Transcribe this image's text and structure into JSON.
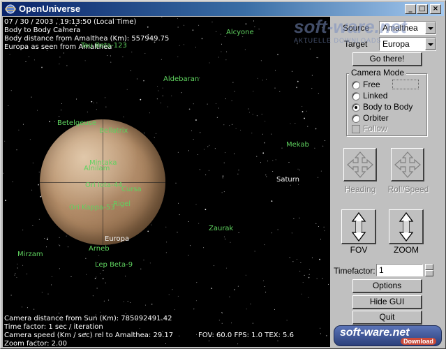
{
  "window": {
    "title": "OpenUniverse",
    "controls": {
      "minimize": "_",
      "maximize": "□",
      "close": "×"
    }
  },
  "hud": {
    "top_lines": [
      "07 / 30 / 2003 , 19:13:50 (Local Time)",
      "Body to Body Camera",
      "Body distance from Amalthea (Km): 557949.75",
      "Europa as seen from Amalthea"
    ],
    "bottom_lines": [
      "Camera distance from Sun (Km): 785092491.42",
      "Time factor: 1 sec / iteration",
      "Camera speed (Km / sec) rel to Amalthea: 29.17",
      "Zoom factor: 2.00"
    ],
    "stats": "FOV: 60.0  FPS: 1.0 TEX: 5.6"
  },
  "stars": [
    {
      "name": "Alcyone"
    },
    {
      "name": "Tau Beta-123"
    },
    {
      "name": "Aldebaran"
    },
    {
      "name": "Betelgeuse"
    },
    {
      "name": "Bellatrix"
    },
    {
      "name": "Mintaka"
    },
    {
      "name": "Alnilam"
    },
    {
      "name": "Ori Iota-44"
    },
    {
      "name": "Cursa"
    },
    {
      "name": "Rigel"
    },
    {
      "name": "Ori Kappa-53"
    },
    {
      "name": "Mekab"
    },
    {
      "name": "Zaurak"
    },
    {
      "name": "Arneb"
    },
    {
      "name": "Mirzam"
    },
    {
      "name": "Lep Beta-9"
    }
  ],
  "bodies": {
    "saturn": "Saturn",
    "europa": "Europa"
  },
  "panel": {
    "source_label": "Source",
    "source_value": "Amalthea",
    "target_label": "Target",
    "target_value": "Europa",
    "go_button": "Go there!",
    "camera_mode": {
      "title": "Camera Mode",
      "options": [
        "Free",
        "Linked",
        "Body to Body",
        "Orbiter"
      ],
      "selected": "Body to Body",
      "follow_label": "Follow"
    },
    "heading_label": "Heading",
    "roll_speed_label": "Roll/Speed",
    "fov_label": "FOV",
    "zoom_label": "ZOOM",
    "timefactor_label": "Timefactor:",
    "timefactor_value": "1",
    "options_button": "Options",
    "hide_gui_button": "Hide GUI",
    "quit_button": "Quit"
  },
  "watermark": {
    "main": "soft-ware.net",
    "sub": "AKTUELLE DOWNLOADS",
    "footer": "soft-ware.net",
    "footer_sub": "Download"
  },
  "colors": {
    "star_label": "#5fd35f",
    "title_bar": "#0a246a",
    "panel_bg": "#c0c0c0"
  }
}
